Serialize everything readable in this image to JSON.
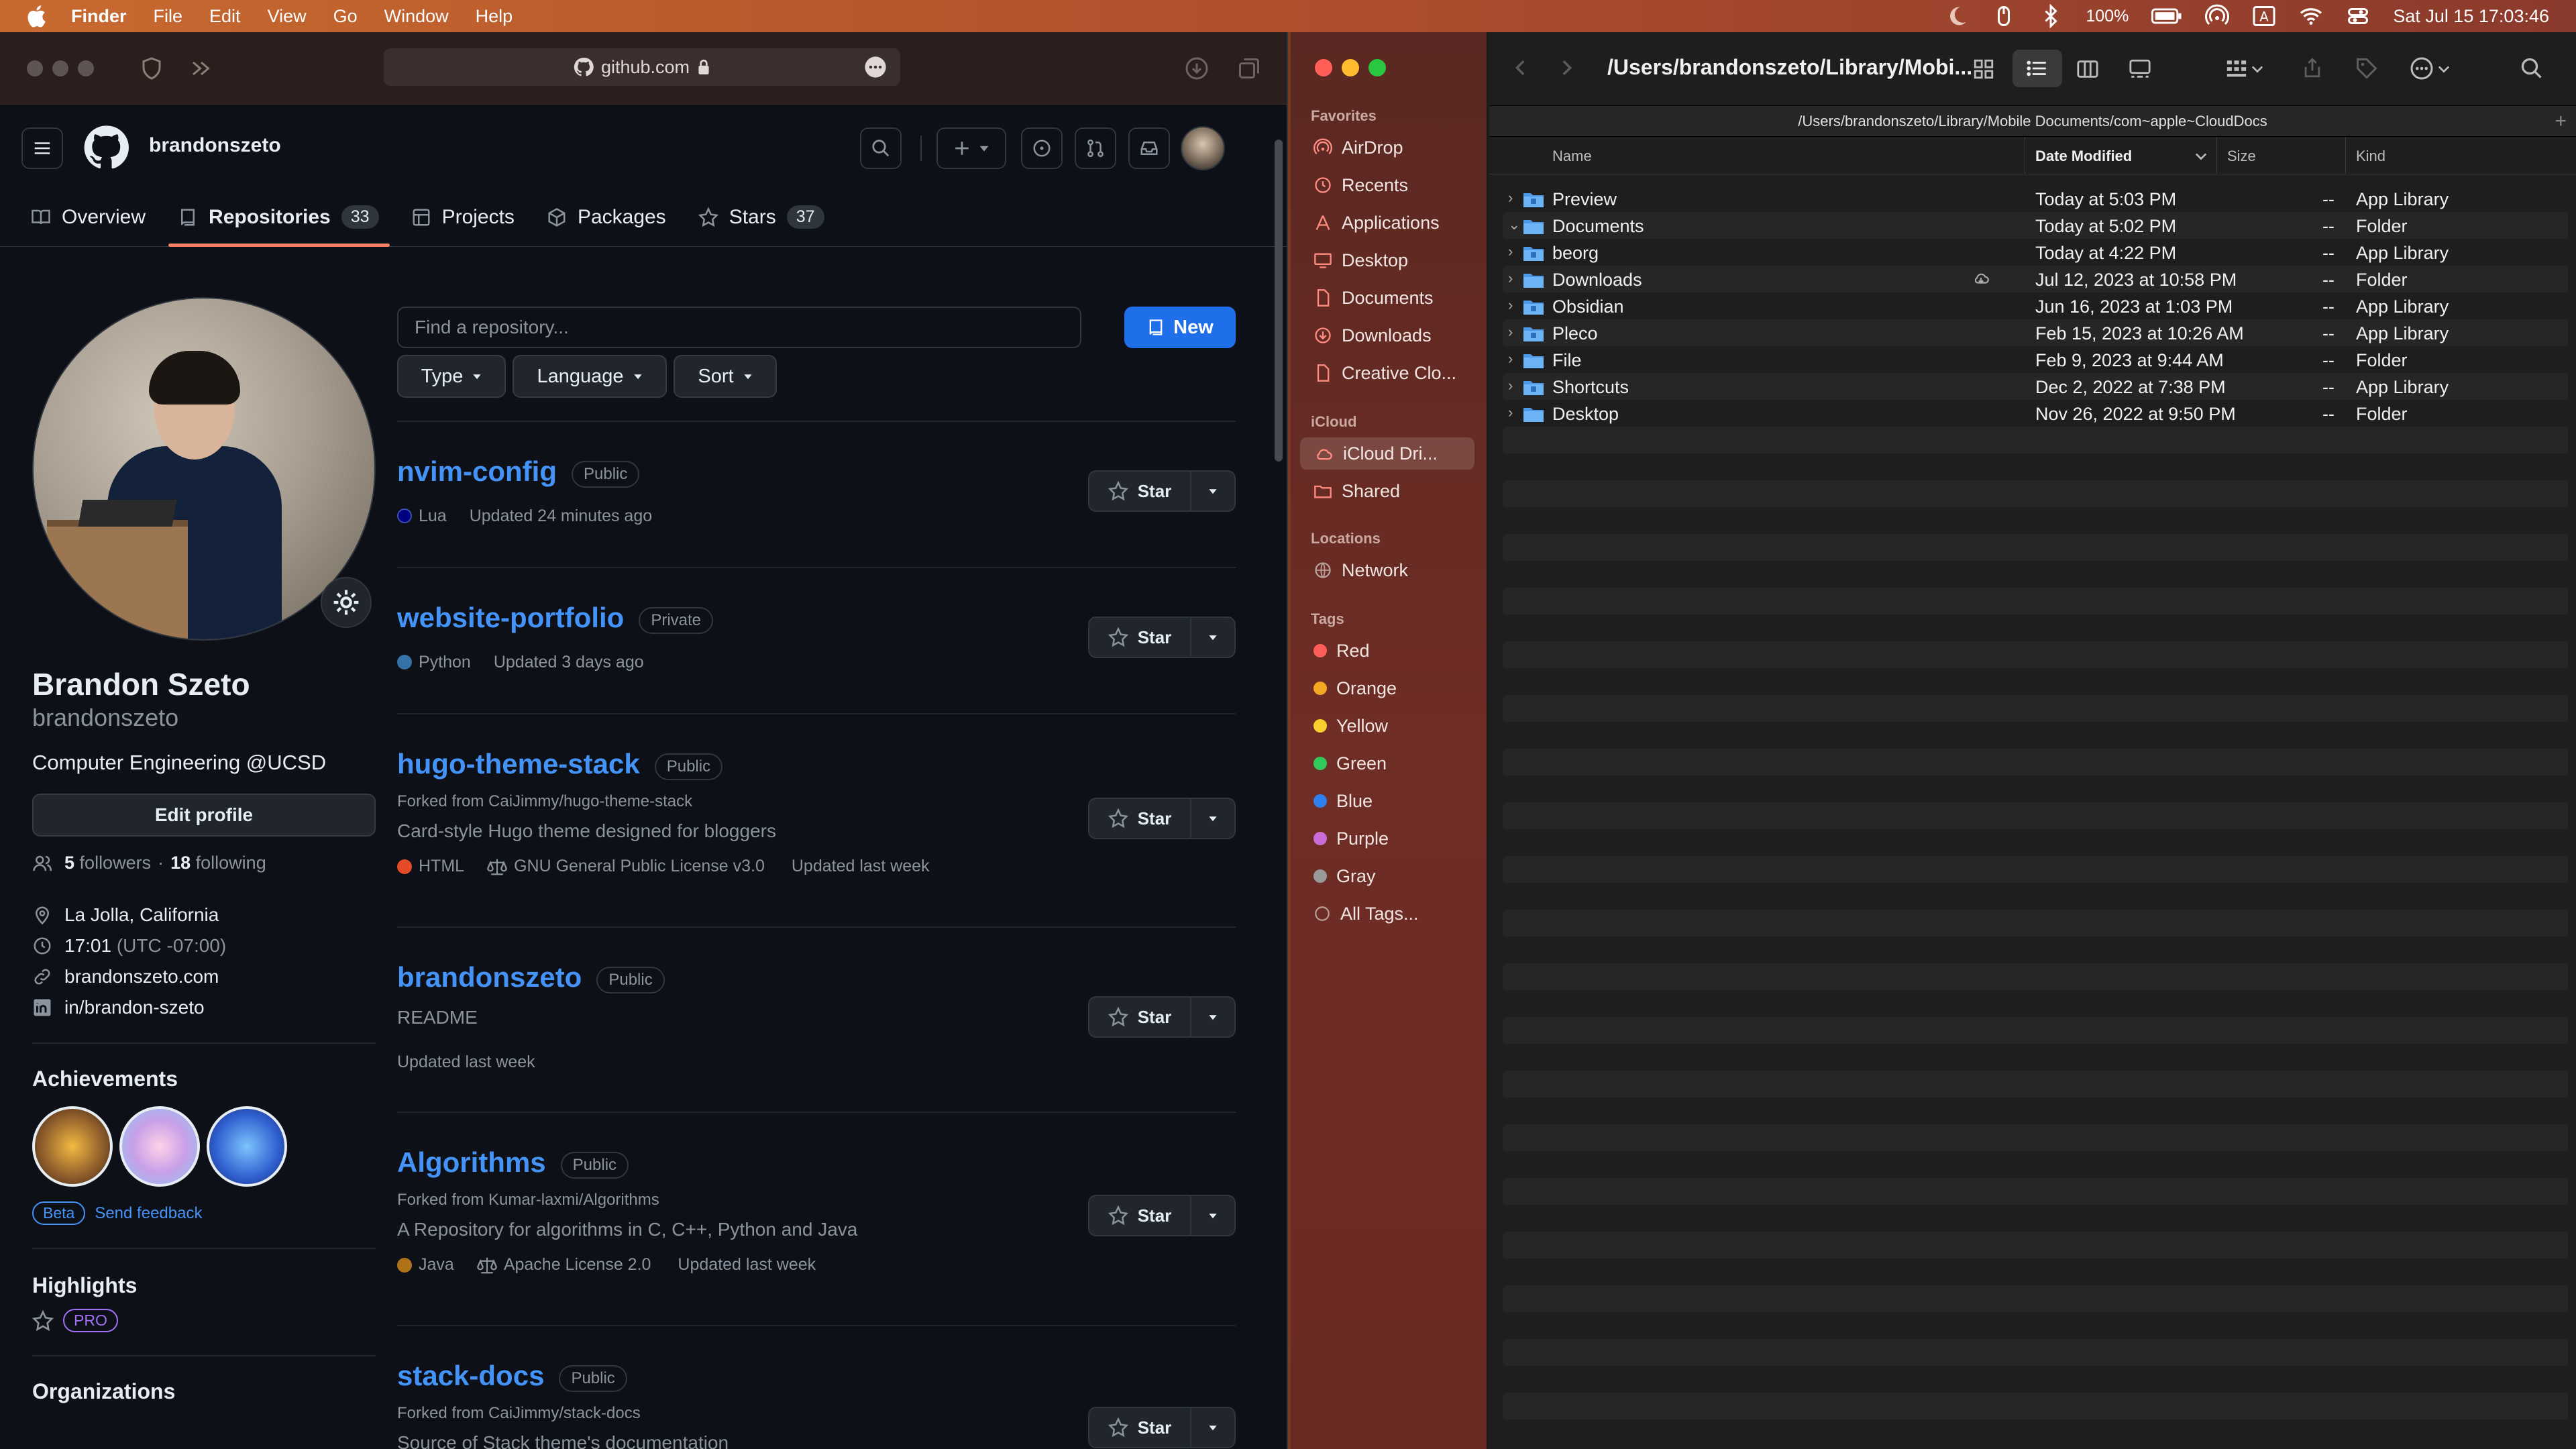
{
  "menubar": {
    "app": "Finder",
    "items": [
      "File",
      "Edit",
      "View",
      "Go",
      "Window",
      "Help"
    ],
    "battery": "100%",
    "datetime": "Sat Jul 15  17:03:46"
  },
  "browser": {
    "url": "github.com",
    "username": "brandonszeto",
    "tabs": [
      {
        "label": "Overview"
      },
      {
        "label": "Repositories",
        "count": "33"
      },
      {
        "label": "Projects"
      },
      {
        "label": "Packages"
      },
      {
        "label": "Stars",
        "count": "37"
      }
    ],
    "profile": {
      "name": "Brandon Szeto",
      "login": "brandonszeto",
      "bio": "Computer Engineering @UCSD",
      "edit_label": "Edit profile",
      "followers": "5",
      "followers_label": "followers",
      "following": "18",
      "following_label": "following",
      "location": "La Jolla, California",
      "time": "17:01",
      "tz": "(UTC -07:00)",
      "website": "brandonszeto.com",
      "linkedin": "in/brandon-szeto",
      "achievements_title": "Achievements",
      "beta": "Beta",
      "feedback": "Send feedback",
      "highlights_title": "Highlights",
      "pro": "PRO",
      "bottom_partial": "Organizations"
    },
    "repo_controls": {
      "search_placeholder": "Find a repository...",
      "new_label": "New",
      "type": "Type",
      "language": "Language",
      "sort": "Sort"
    },
    "star_label": "Star",
    "repos": [
      {
        "name": "nvim-config",
        "visibility": "Public",
        "lang": "Lua",
        "lang_color": "#000080",
        "updated": "Updated 24 minutes ago"
      },
      {
        "name": "website-portfolio",
        "visibility": "Private",
        "lang": "Python",
        "lang_color": "#3572A5",
        "updated": "Updated 3 days ago"
      },
      {
        "name": "hugo-theme-stack",
        "visibility": "Public",
        "forked": "Forked from CaiJimmy/hugo-theme-stack",
        "desc": "Card-style Hugo theme designed for bloggers",
        "lang": "HTML",
        "lang_color": "#e34c26",
        "license": "GNU General Public License v3.0",
        "updated": "Updated last week"
      },
      {
        "name": "brandonszeto",
        "visibility": "Public",
        "desc": "README",
        "updated": "Updated last week"
      },
      {
        "name": "Algorithms",
        "visibility": "Public",
        "forked": "Forked from Kumar-laxmi/Algorithms",
        "desc": "A Repository for algorithms in C, C++, Python and Java",
        "lang": "Java",
        "lang_color": "#b07219",
        "license": "Apache License 2.0",
        "updated": "Updated last week"
      },
      {
        "name": "stack-docs",
        "visibility": "Public",
        "forked": "Forked from CaiJimmy/stack-docs",
        "desc": "Source of Stack theme's documentation"
      }
    ]
  },
  "finder": {
    "title": "/Users/brandonszeto/Library/Mobi...",
    "path": "/Users/brandonszeto/Library/Mobile Documents/com~apple~CloudDocs",
    "favorites_label": "Favorites",
    "favorites": [
      "AirDrop",
      "Recents",
      "Applications",
      "Desktop",
      "Documents",
      "Downloads",
      "Creative Clo..."
    ],
    "icloud_label": "iCloud",
    "icloud": [
      "iCloud Dri...",
      "Shared"
    ],
    "locations_label": "Locations",
    "locations": [
      "Network"
    ],
    "tags_label": "Tags",
    "tags": [
      {
        "name": "Red",
        "color": "#ff5f57"
      },
      {
        "name": "Orange",
        "color": "#f5a623"
      },
      {
        "name": "Yellow",
        "color": "#f8d030"
      },
      {
        "name": "Green",
        "color": "#34c759"
      },
      {
        "name": "Blue",
        "color": "#2f80ed"
      },
      {
        "name": "Purple",
        "color": "#c86dd7"
      },
      {
        "name": "Gray",
        "color": "#9a9a9a"
      },
      {
        "name": "All Tags..."
      }
    ],
    "columns": {
      "name": "Name",
      "date": "Date Modified",
      "size": "Size",
      "kind": "Kind"
    },
    "files": [
      {
        "name": "Preview",
        "date": "Today at 5:03 PM",
        "size": "--",
        "kind": "App Library"
      },
      {
        "name": "Documents",
        "date": "Today at 5:02 PM",
        "size": "--",
        "kind": "Folder"
      },
      {
        "name": "beorg",
        "date": "Today at 4:22 PM",
        "size": "--",
        "kind": "App Library"
      },
      {
        "name": "Downloads",
        "date": "Jul 12, 2023 at 10:58 PM",
        "size": "--",
        "kind": "Folder"
      },
      {
        "name": "Obsidian",
        "date": "Jun 16, 2023 at 1:03 PM",
        "size": "--",
        "kind": "App Library"
      },
      {
        "name": "Pleco",
        "date": "Feb 15, 2023 at 10:26 AM",
        "size": "--",
        "kind": "App Library"
      },
      {
        "name": "File",
        "date": "Feb 9, 2023 at 9:44 AM",
        "size": "--",
        "kind": "Folder"
      },
      {
        "name": "Shortcuts",
        "date": "Dec 2, 2022 at 7:38 PM",
        "size": "--",
        "kind": "App Library"
      },
      {
        "name": "Desktop",
        "date": "Nov 26, 2022 at 9:50 PM",
        "size": "--",
        "kind": "Folder"
      }
    ]
  },
  "colors": {
    "accent": "#4493f8",
    "new_button": "#1f6feb",
    "tab_underline": "#f78166"
  }
}
